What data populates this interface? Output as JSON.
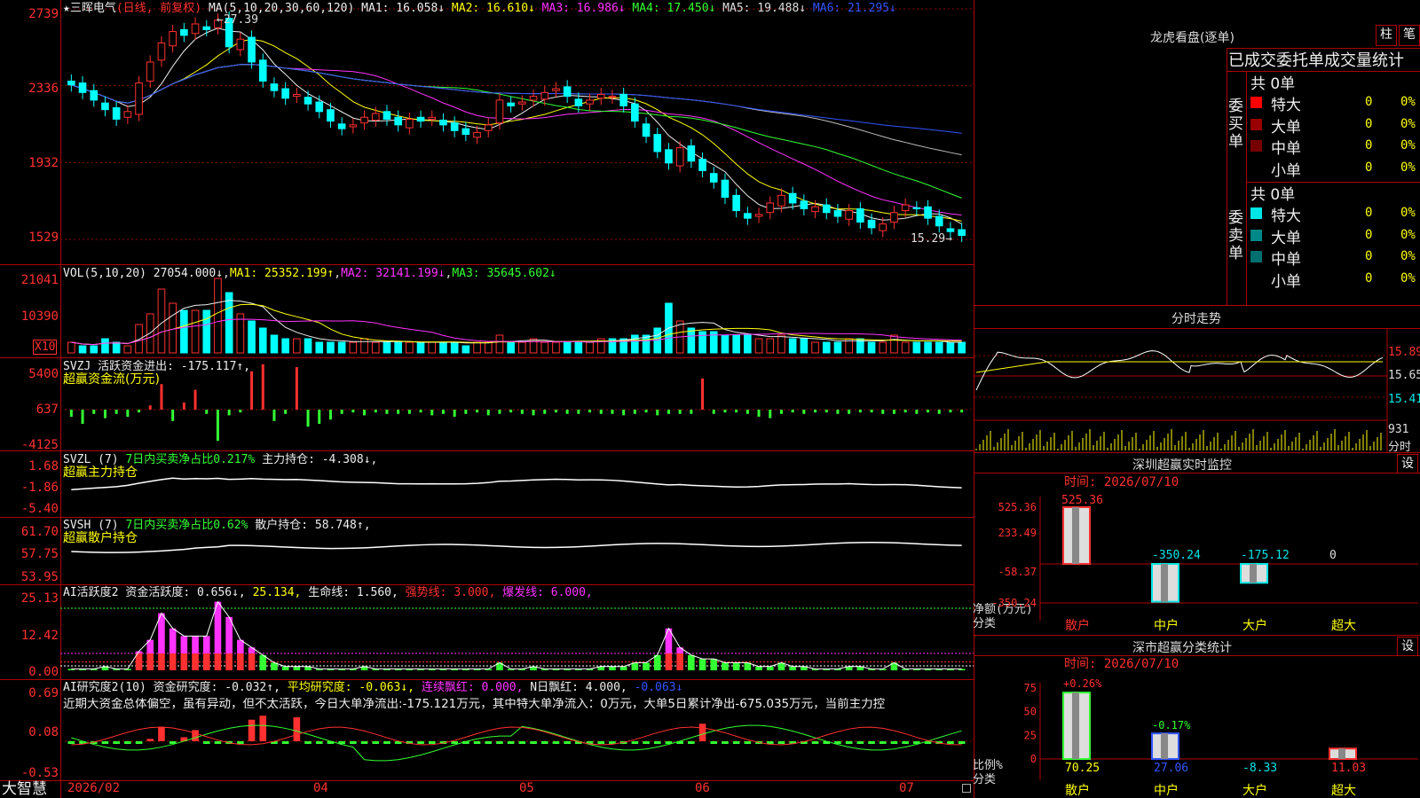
{
  "chart_header": {
    "title": "★三晖电气",
    "mode": "(日线, 前复权)",
    "ma_label": "MA(5,10,20,30,60,120)",
    "ma1": "MA1: 16.058↓",
    "ma2": "MA2: 16.610↓",
    "ma3": "MA3: 16.986↓",
    "ma4": "MA4: 17.450↓",
    "ma5": "MA5: 19.488↓",
    "ma6": "MA6: 21.295↓",
    "high_mark": "27.39",
    "low_mark": "15.29"
  },
  "price_axis": [
    "2739",
    "2336",
    "1932",
    "1529"
  ],
  "vol_panel": {
    "label": "VOL(5,10,20)",
    "value": "27054.000↓",
    "ma1": "MA1: 25352.199↑",
    "ma2": "MA2: 32141.199↓",
    "ma3": "MA3: 35645.602↓",
    "axis": [
      "21041",
      "10390"
    ],
    "unit": "X10"
  },
  "svzj_panel": {
    "label": "SVZJ  活跃资金进出: -175.117↑,",
    "sub": "超赢资金流(万元)",
    "axis": [
      "5400",
      "637",
      "-4125"
    ]
  },
  "svzl_panel": {
    "label": "SVZL (7)",
    "part2": "7日内买卖净占比0.217%",
    "part3": "主力持仓: -4.308↓,",
    "sub": "超赢主力持仓",
    "axis": [
      "1.68",
      "-1.86",
      "-5.40"
    ]
  },
  "svsh_panel": {
    "label": "SVSH (7)",
    "part2": "7日内买卖净占比0.62%",
    "part3": "散户持仓: 58.748↑,",
    "sub": "超赢散户持仓",
    "axis": [
      "61.70",
      "57.75",
      "53.95"
    ]
  },
  "ai1_panel": {
    "label": "AI活跃度2",
    "p1": "资金活跃度: 0.656↓,",
    "p2": "25.134,",
    "p3": "生命线: 1.560,",
    "p4": "强势线: 3.000,",
    "p5": "爆发线: 6.000,",
    "axis": [
      "25.13",
      "12.42",
      "0.00"
    ]
  },
  "ai2_panel": {
    "label": "AI研究度2(10)",
    "p1": "资金研究度: -0.032↑,",
    "p2": "平均研究度: -0.063↓,",
    "p3": "连续飘红: 0.000,",
    "p4": "N日飘红: 4.000,",
    "p5": "-0.063↓",
    "comment": "近期大资金总体偏空，虽有异动，但不太活跃，今日大单净流出:-175.121万元，其中特大单净流入：0万元，大单5日累计净出-675.035万元，当前主力控",
    "axis": [
      "0.69",
      "0.08",
      "-0.53"
    ]
  },
  "time_axis": [
    "2026/02",
    "04",
    "05",
    "06",
    "07"
  ],
  "brand": "大智慧",
  "right": {
    "dragon_title": "龙虎看盘(逐单)",
    "btn_zhu": "柱",
    "btn_bi": "笔",
    "stats_title": "已成交委托单成交量统计",
    "buy_label": "委买单",
    "sell_label": "委卖单",
    "buy_total": "共 0单",
    "sell_total": "共 0单",
    "buy_rows": [
      {
        "name": "特大",
        "val": "0",
        "pct": "0%",
        "color": "#ff0000"
      },
      {
        "name": "大单",
        "val": "0",
        "pct": "0%",
        "color": "#990000"
      },
      {
        "name": "中单",
        "val": "0",
        "pct": "0%",
        "color": "#770000"
      },
      {
        "name": "小单",
        "val": "0",
        "pct": "0%",
        "color": "#000000"
      }
    ],
    "sell_rows": [
      {
        "name": "特大",
        "val": "0",
        "pct": "0%",
        "color": "#00e5e5"
      },
      {
        "name": "大单",
        "val": "0",
        "pct": "0%",
        "color": "#008888"
      },
      {
        "name": "中单",
        "val": "0",
        "pct": "0%",
        "color": "#006f6f"
      },
      {
        "name": "小单",
        "val": "0",
        "pct": "0%",
        "color": "#000000"
      }
    ],
    "intraday_title": "分时走势",
    "intraday_axis": [
      "15.89",
      "15.65",
      "15.41"
    ],
    "intraday_vol": [
      "931",
      "分时"
    ],
    "monitor_title": "深圳超赢实时监控",
    "monitor_btn": "设",
    "monitor_time": "时间: 2026/07/10",
    "monitor_axis": [
      "525.36",
      "233.49",
      "-58.37",
      "-350.24"
    ],
    "monitor_values": [
      "525.36",
      "-350.24",
      "-175.12",
      "0"
    ],
    "monitor_ylabel": "净额(万元)",
    "monitor_xlabel": "分类",
    "categories": [
      "散户",
      "中户",
      "大户",
      "超大"
    ],
    "stats2_title": "深市超赢分类统计",
    "stats2_btn": "设",
    "stats2_time": "时间: 2026/07/10",
    "stats2_axis": [
      "75",
      "50",
      "25",
      "0"
    ],
    "stats2_top": [
      "+0.26%",
      "-0.17%"
    ],
    "stats2_values": [
      "70.25",
      "27.06",
      "-8.33",
      "11.03"
    ],
    "stats2_ylabel": "比例%",
    "stats2_xlabel": "分类"
  },
  "chart_data": {
    "type": "candlestick",
    "price_range": [
      15.29,
      27.39
    ],
    "closes": [
      23.4,
      23.0,
      22.6,
      22.1,
      21.6,
      22.0,
      23.5,
      24.6,
      25.6,
      26.2,
      26.0,
      26.6,
      26.3,
      26.8,
      25.4,
      25.8,
      24.6,
      23.6,
      23.1,
      22.7,
      22.9,
      22.4,
      22.0,
      21.5,
      21.1,
      21.3,
      21.7,
      21.9,
      21.6,
      21.3,
      21.6,
      21.5,
      21.7,
      21.3,
      21.0,
      20.8,
      20.9,
      21.3,
      22.6,
      22.3,
      22.5,
      22.8,
      23.0,
      23.2,
      22.8,
      22.3,
      22.6,
      22.9,
      22.8,
      22.3,
      21.5,
      20.7,
      19.9,
      19.3,
      20.1,
      19.4,
      18.9,
      18.3,
      17.5,
      16.8,
      16.4,
      16.6,
      17.2,
      17.6,
      17.2,
      16.9,
      17.0,
      16.7,
      16.5,
      16.8,
      16.2,
      15.9,
      16.1,
      16.7,
      17.1,
      16.9,
      16.4,
      16.0,
      15.7,
      15.5
    ],
    "volumes": [
      3,
      2,
      2,
      4,
      3,
      2,
      8,
      11,
      18,
      14,
      12,
      12,
      12,
      21,
      17,
      11,
      9,
      7,
      5,
      4,
      4,
      4,
      3,
      3,
      3,
      3,
      4,
      3,
      3,
      3,
      3,
      3,
      3,
      3,
      3,
      2,
      3,
      3,
      5,
      3,
      3,
      4,
      3,
      3,
      3,
      3,
      3,
      4,
      4,
      4,
      5,
      5,
      7,
      14,
      9,
      7,
      6,
      6,
      5,
      5,
      5,
      4,
      4,
      5,
      4,
      4,
      3,
      3,
      3,
      4,
      4,
      3,
      3,
      5,
      3,
      3,
      3,
      3,
      3,
      3
    ],
    "svzj": [
      -0.5,
      -1,
      -0.3,
      -0.6,
      -0.3,
      -0.5,
      -0.2,
      0.3,
      1.8,
      -0.8,
      0.5,
      1.4,
      -0.3,
      -2.2,
      -0.4,
      -0.2,
      2.7,
      3.2,
      -0.8,
      -0.3,
      3.0,
      -1.2,
      -1.0,
      -0.7,
      -0.3,
      -0.2,
      -0.4,
      -0.2,
      -0.3,
      -0.3,
      -0.3,
      -0.2,
      -0.4,
      -0.3,
      -0.5,
      -0.3,
      -0.2,
      -0.4,
      -0.3,
      -0.2,
      -0.3,
      -0.4,
      -0.3,
      -0.2,
      -0.3,
      -0.3,
      -0.2,
      -0.3,
      -0.3,
      -0.4,
      -0.3,
      -0.2,
      -0.4,
      -0.3,
      -0.3,
      -0.3,
      2.2,
      -0.3,
      -0.2,
      -0.2,
      -0.3,
      -0.5,
      -0.6,
      -0.3,
      -0.2,
      -0.3,
      -0.2,
      -0.2,
      -0.3,
      -0.3,
      -0.2,
      -0.2,
      -0.3,
      -0.3,
      -0.2,
      -0.3,
      -0.2,
      -0.3,
      -0.2,
      -0.2
    ]
  }
}
